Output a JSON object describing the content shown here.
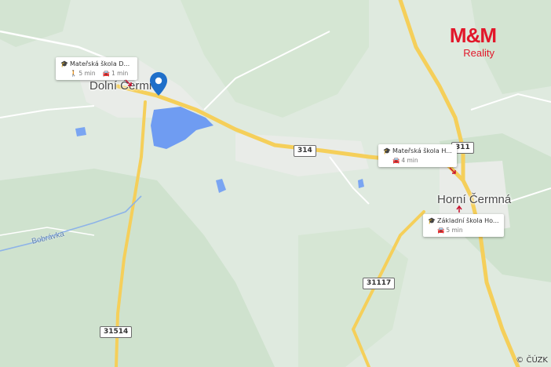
{
  "map": {
    "towns": [
      {
        "name": "Dolní Čermná"
      },
      {
        "name": "Horní Čermná"
      }
    ],
    "river": {
      "name": "Bobrávka"
    },
    "roads": [
      {
        "number": "314"
      },
      {
        "number": "311"
      },
      {
        "number": "31117"
      },
      {
        "number": "31514"
      }
    ],
    "pois": [
      {
        "label": "Mateřská škola D...",
        "walk": "5 min",
        "drive": "1 min",
        "icon": "graduation-cap-icon"
      },
      {
        "label": "Mateřská škola H...",
        "walk": "",
        "drive": "4 min",
        "icon": "graduation-cap-icon"
      },
      {
        "label": "Základní škola Ho...",
        "walk": "",
        "drive": "5 min",
        "icon": "graduation-cap-icon"
      }
    ],
    "attribution": "© ČÚZK",
    "colors": {
      "land": "#dfeadf",
      "forest": "#cde0cc",
      "water": "#6f9cf2",
      "road": "#f5cf5a",
      "pin": "#1f6fc9",
      "brand": "#e2172a"
    }
  },
  "brand": {
    "logo": "M&M",
    "subtitle": "Reality"
  }
}
